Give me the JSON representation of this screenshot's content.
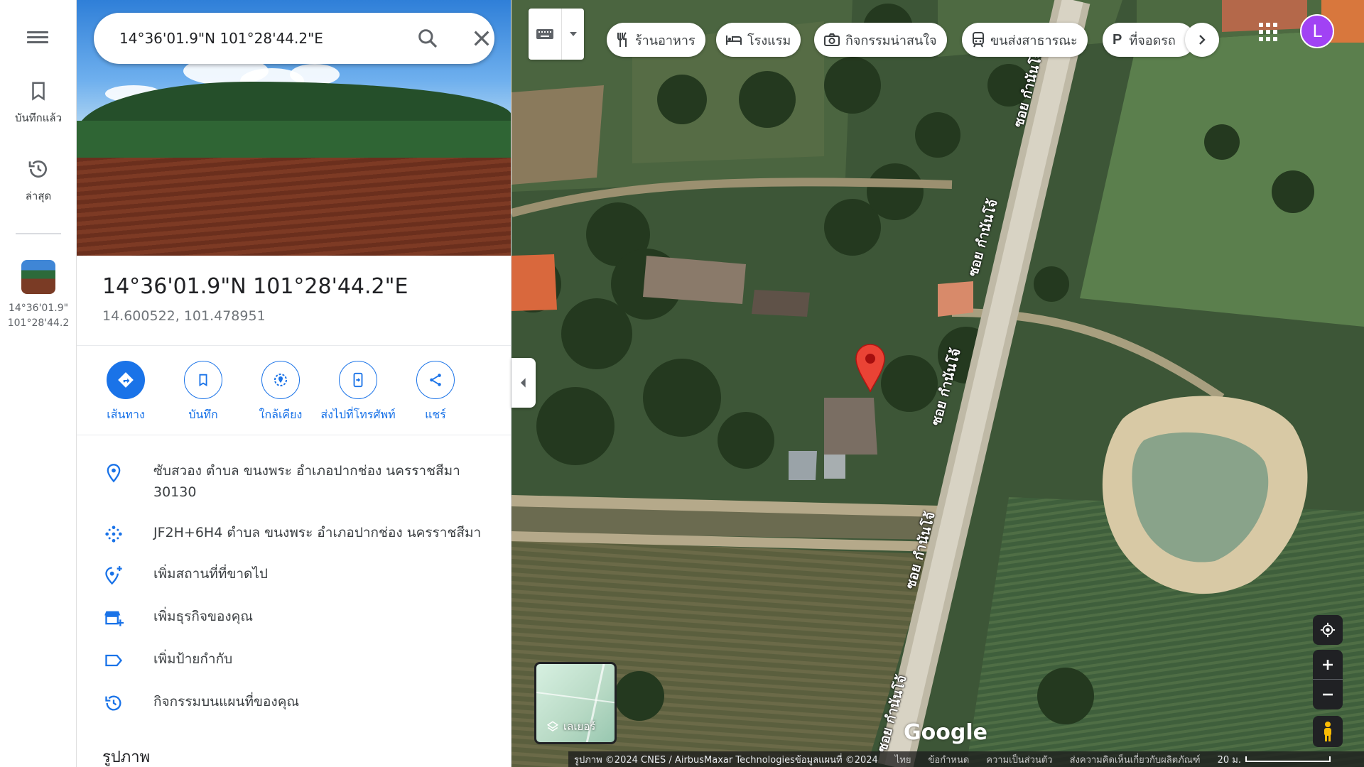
{
  "search": {
    "value": "14°36'01.9\"N 101°28'44.2\"E"
  },
  "rail": {
    "saved_label": "บันทึกแล้ว",
    "recent_label": "ล่าสุด",
    "recent_item_line1": "14°36'01.9\"",
    "recent_item_line2": "101°28'44.2"
  },
  "place": {
    "title": "14°36'01.9\"N 101°28'44.2\"E",
    "coords": "14.600522, 101.478951"
  },
  "actions": [
    {
      "label": "เส้นทาง",
      "icon": "directions-icon"
    },
    {
      "label": "บันทึก",
      "icon": "bookmark-icon"
    },
    {
      "label": "ใกล้เคียง",
      "icon": "nearby-icon"
    },
    {
      "label": "ส่งไปที่โทรศัพท์",
      "icon": "send-to-phone-icon"
    },
    {
      "label": "แชร์",
      "icon": "share-icon"
    }
  ],
  "info": {
    "address_line1": "ซับสวอง ตำบล ขนงพระ อำเภอปากช่อง นครราชสีมา",
    "address_line2": "30130",
    "plus_code": "JF2H+6H4 ตำบล ขนงพระ อำเภอปากช่อง นครราชสีมา",
    "add_missing_place": "เพิ่มสถานที่ที่ขาดไป",
    "add_business": "เพิ่มธุรกิจของคุณ",
    "add_label": "เพิ่มป้ายกำกับ",
    "map_activity": "กิจกรรมบนแผนที่ของคุณ"
  },
  "photos_heading": "รูปภาพ",
  "chips": [
    {
      "label": "ร้านอาหาร",
      "icon": "restaurant-icon"
    },
    {
      "label": "โรงแรม",
      "icon": "hotel-icon"
    },
    {
      "label": "กิจกรรมน่าสนใจ",
      "icon": "camera-icon"
    },
    {
      "label": "ขนส่งสาธารณะ",
      "icon": "transit-icon"
    },
    {
      "label": "ที่จอดรถ",
      "icon": "parking-icon"
    }
  ],
  "user_initial": "L",
  "layers_label": "เลเยอร์",
  "google_logo": "Google",
  "road_name": "ซอย กำนันโจ้",
  "footer": {
    "imagery": "รูปภาพ ©2024 CNES / AirbusMaxar Technologiesข้อมูลแผนที่ ©2024",
    "lang": "ไทย",
    "terms": "ข้อกำหนด",
    "privacy": "ความเป็นส่วนตัว",
    "feedback": "ส่งความคิดเห็นเกี่ยวกับผลิตภัณฑ์",
    "scale": "20 ม."
  },
  "colors": {
    "accent": "#1a73e8",
    "pin": "#ea4335",
    "avatar": "#a142f4"
  }
}
